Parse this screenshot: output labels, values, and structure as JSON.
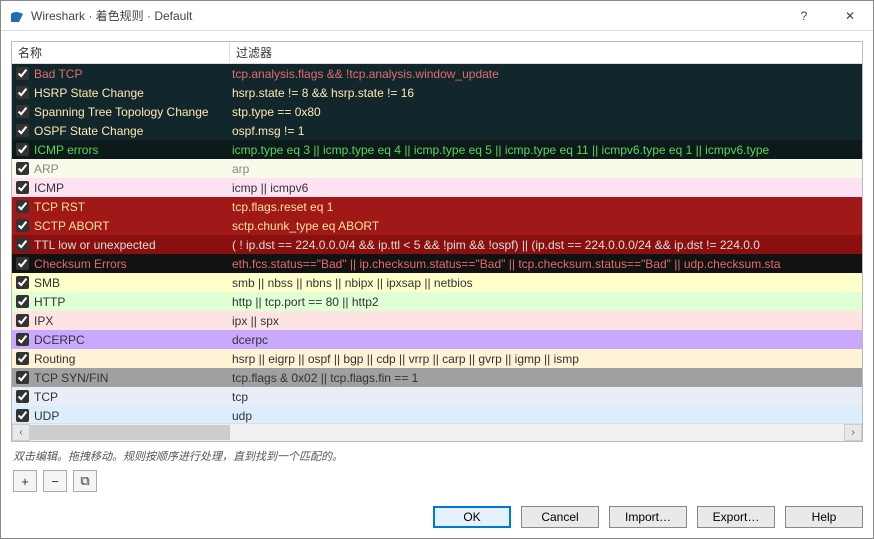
{
  "window": {
    "title": "Wireshark · 着色规则 · Default",
    "help_glyph": "?",
    "close_glyph": "✕"
  },
  "headers": {
    "name": "名称",
    "filter": "过滤器"
  },
  "rules": [
    {
      "name": "Bad TCP",
      "filter": "tcp.analysis.flags && !tcp.analysis.window_update",
      "bg": "#12272b",
      "fg": "#e06c6c",
      "checked": true
    },
    {
      "name": "HSRP State Change",
      "filter": "hsrp.state != 8 && hsrp.state != 16",
      "bg": "#12272b",
      "fg": "#ffe8b0",
      "checked": true
    },
    {
      "name": "Spanning Tree Topology  Change",
      "filter": "stp.type == 0x80",
      "bg": "#12272b",
      "fg": "#ffe8b0",
      "checked": true
    },
    {
      "name": "OSPF State Change",
      "filter": "ospf.msg != 1",
      "bg": "#12272b",
      "fg": "#ffe8b0",
      "checked": true
    },
    {
      "name": "ICMP errors",
      "filter": "icmp.type eq 3 || icmp.type eq 4 || icmp.type eq 5 || icmp.type eq 11 || icmpv6.type eq 1 || icmpv6.type",
      "bg": "#0d1a1a",
      "fg": "#59d659",
      "checked": true
    },
    {
      "name": "ARP",
      "filter": "arp",
      "bg": "#fafaea",
      "fg": "#888",
      "checked": true
    },
    {
      "name": "ICMP",
      "filter": "icmp || icmpv6",
      "bg": "#fde2f1",
      "fg": "#333",
      "checked": true
    },
    {
      "name": "TCP RST",
      "filter": "tcp.flags.reset eq 1",
      "bg": "#a01818",
      "fg": "#ffe49c",
      "checked": true
    },
    {
      "name": "SCTP ABORT",
      "filter": "sctp.chunk_type eq ABORT",
      "bg": "#a01818",
      "fg": "#ffe49c",
      "checked": true
    },
    {
      "name": "TTL low or unexpected",
      "filter": "( ! ip.dst == 224.0.0.0/4 && ip.ttl < 5 && !pim && !ospf) || (ip.dst == 224.0.0.0/24 && ip.dst != 224.0.0",
      "bg": "#8a0f0f",
      "fg": "#ddd",
      "checked": true
    },
    {
      "name": "Checksum Errors",
      "filter": "eth.fcs.status==\"Bad\" || ip.checksum.status==\"Bad\" || tcp.checksum.status==\"Bad\" || udp.checksum.sta",
      "bg": "#121212",
      "fg": "#e06c6c",
      "checked": true
    },
    {
      "name": "SMB",
      "filter": "smb || nbss || nbns || nbipx || ipxsap || netbios",
      "bg": "#ffffcc",
      "fg": "#333",
      "checked": true
    },
    {
      "name": "HTTP",
      "filter": "http || tcp.port == 80 || http2",
      "bg": "#e0ffd5",
      "fg": "#333",
      "checked": true
    },
    {
      "name": "IPX",
      "filter": "ipx || spx",
      "bg": "#ffe3e3",
      "fg": "#333",
      "checked": true
    },
    {
      "name": "DCERPC",
      "filter": "dcerpc",
      "bg": "#c9a9ff",
      "fg": "#333",
      "checked": true
    },
    {
      "name": "Routing",
      "filter": "hsrp || eigrp || ospf || bgp || cdp || vrrp || carp || gvrp || igmp || ismp",
      "bg": "#fff3d6",
      "fg": "#333",
      "checked": true
    },
    {
      "name": "TCP SYN/FIN",
      "filter": "tcp.flags & 0x02 || tcp.flags.fin == 1",
      "bg": "#a0a0a0",
      "fg": "#333",
      "checked": true
    },
    {
      "name": "TCP",
      "filter": "tcp",
      "bg": "#e8eef7",
      "fg": "#333",
      "checked": true
    },
    {
      "name": "UDP",
      "filter": "udp",
      "bg": "#dcedfb",
      "fg": "#333",
      "checked": true
    }
  ],
  "hint": "双击编辑。拖拽移动。规则按顺序进行处理，直到找到一个匹配的。",
  "toolbar": {
    "add": "+",
    "remove": "−",
    "copy": "⧉"
  },
  "buttons": {
    "ok": "OK",
    "cancel": "Cancel",
    "import": "Import…",
    "export": "Export…",
    "help": "Help"
  },
  "scroll": {
    "left": "‹",
    "right": "›"
  }
}
